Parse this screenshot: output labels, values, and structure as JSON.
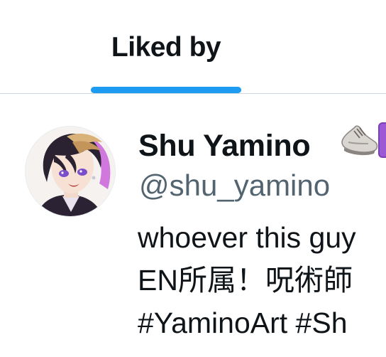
{
  "tabs": [
    {
      "label": "Liked by",
      "active": true
    }
  ],
  "colors": {
    "accent": "#1d9bf0",
    "text_primary": "#0f1419",
    "text_secondary": "#536471",
    "divider": "#cfd9de",
    "badge": "#9b59d6"
  },
  "user": {
    "display_name": "Shu Yamino",
    "handle": "@shu_yamino",
    "name_icons": [
      "sneaker-icon",
      "purple-badge-icon"
    ],
    "avatar_icon": "anime-avatar",
    "bio_lines": [
      "whoever this guy",
      "EN所属！呪術師",
      "#YaminoArt #Sh"
    ]
  }
}
